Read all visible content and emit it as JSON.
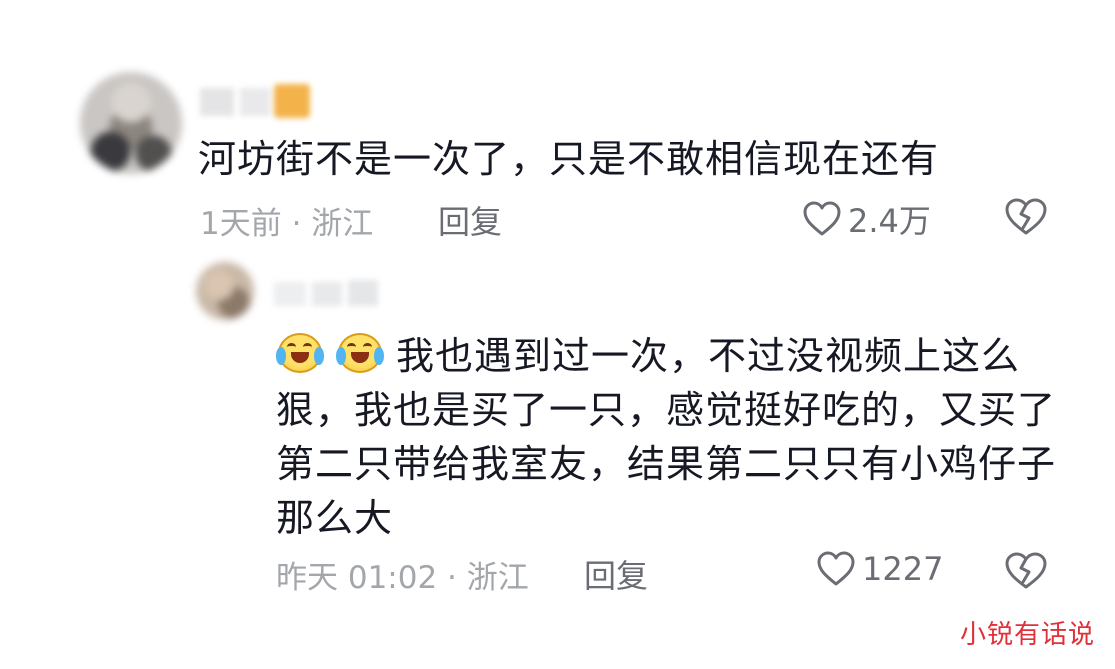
{
  "comments": [
    {
      "text": "河坊街不是一次了，只是不敢相信现在还有",
      "meta": "1天前 · 浙江",
      "reply_label": "回复",
      "likes": "2.4万"
    },
    {
      "text": "我也遇到过一次，不过没视频上这么狠，我也是买了一只，感觉挺好吃的，又买了第二只带给我室友，结果第二只只有小鸡仔子那么大",
      "emoji_prefix": [
        "crying-laughing-emoji",
        "crying-laughing-emoji"
      ],
      "meta": "昨天 01:02 · 浙江",
      "reply_label": "回复",
      "likes": "1227"
    }
  ],
  "icons": {
    "like": "heart-outline-icon",
    "dislike": "broken-heart-icon"
  },
  "watermark": "小锐有话说",
  "colors": {
    "text": "#161823",
    "meta": "#a3a6ab",
    "action": "#6a6d73",
    "watermark": "#e0313a",
    "emoji_face": "#ffe069"
  }
}
